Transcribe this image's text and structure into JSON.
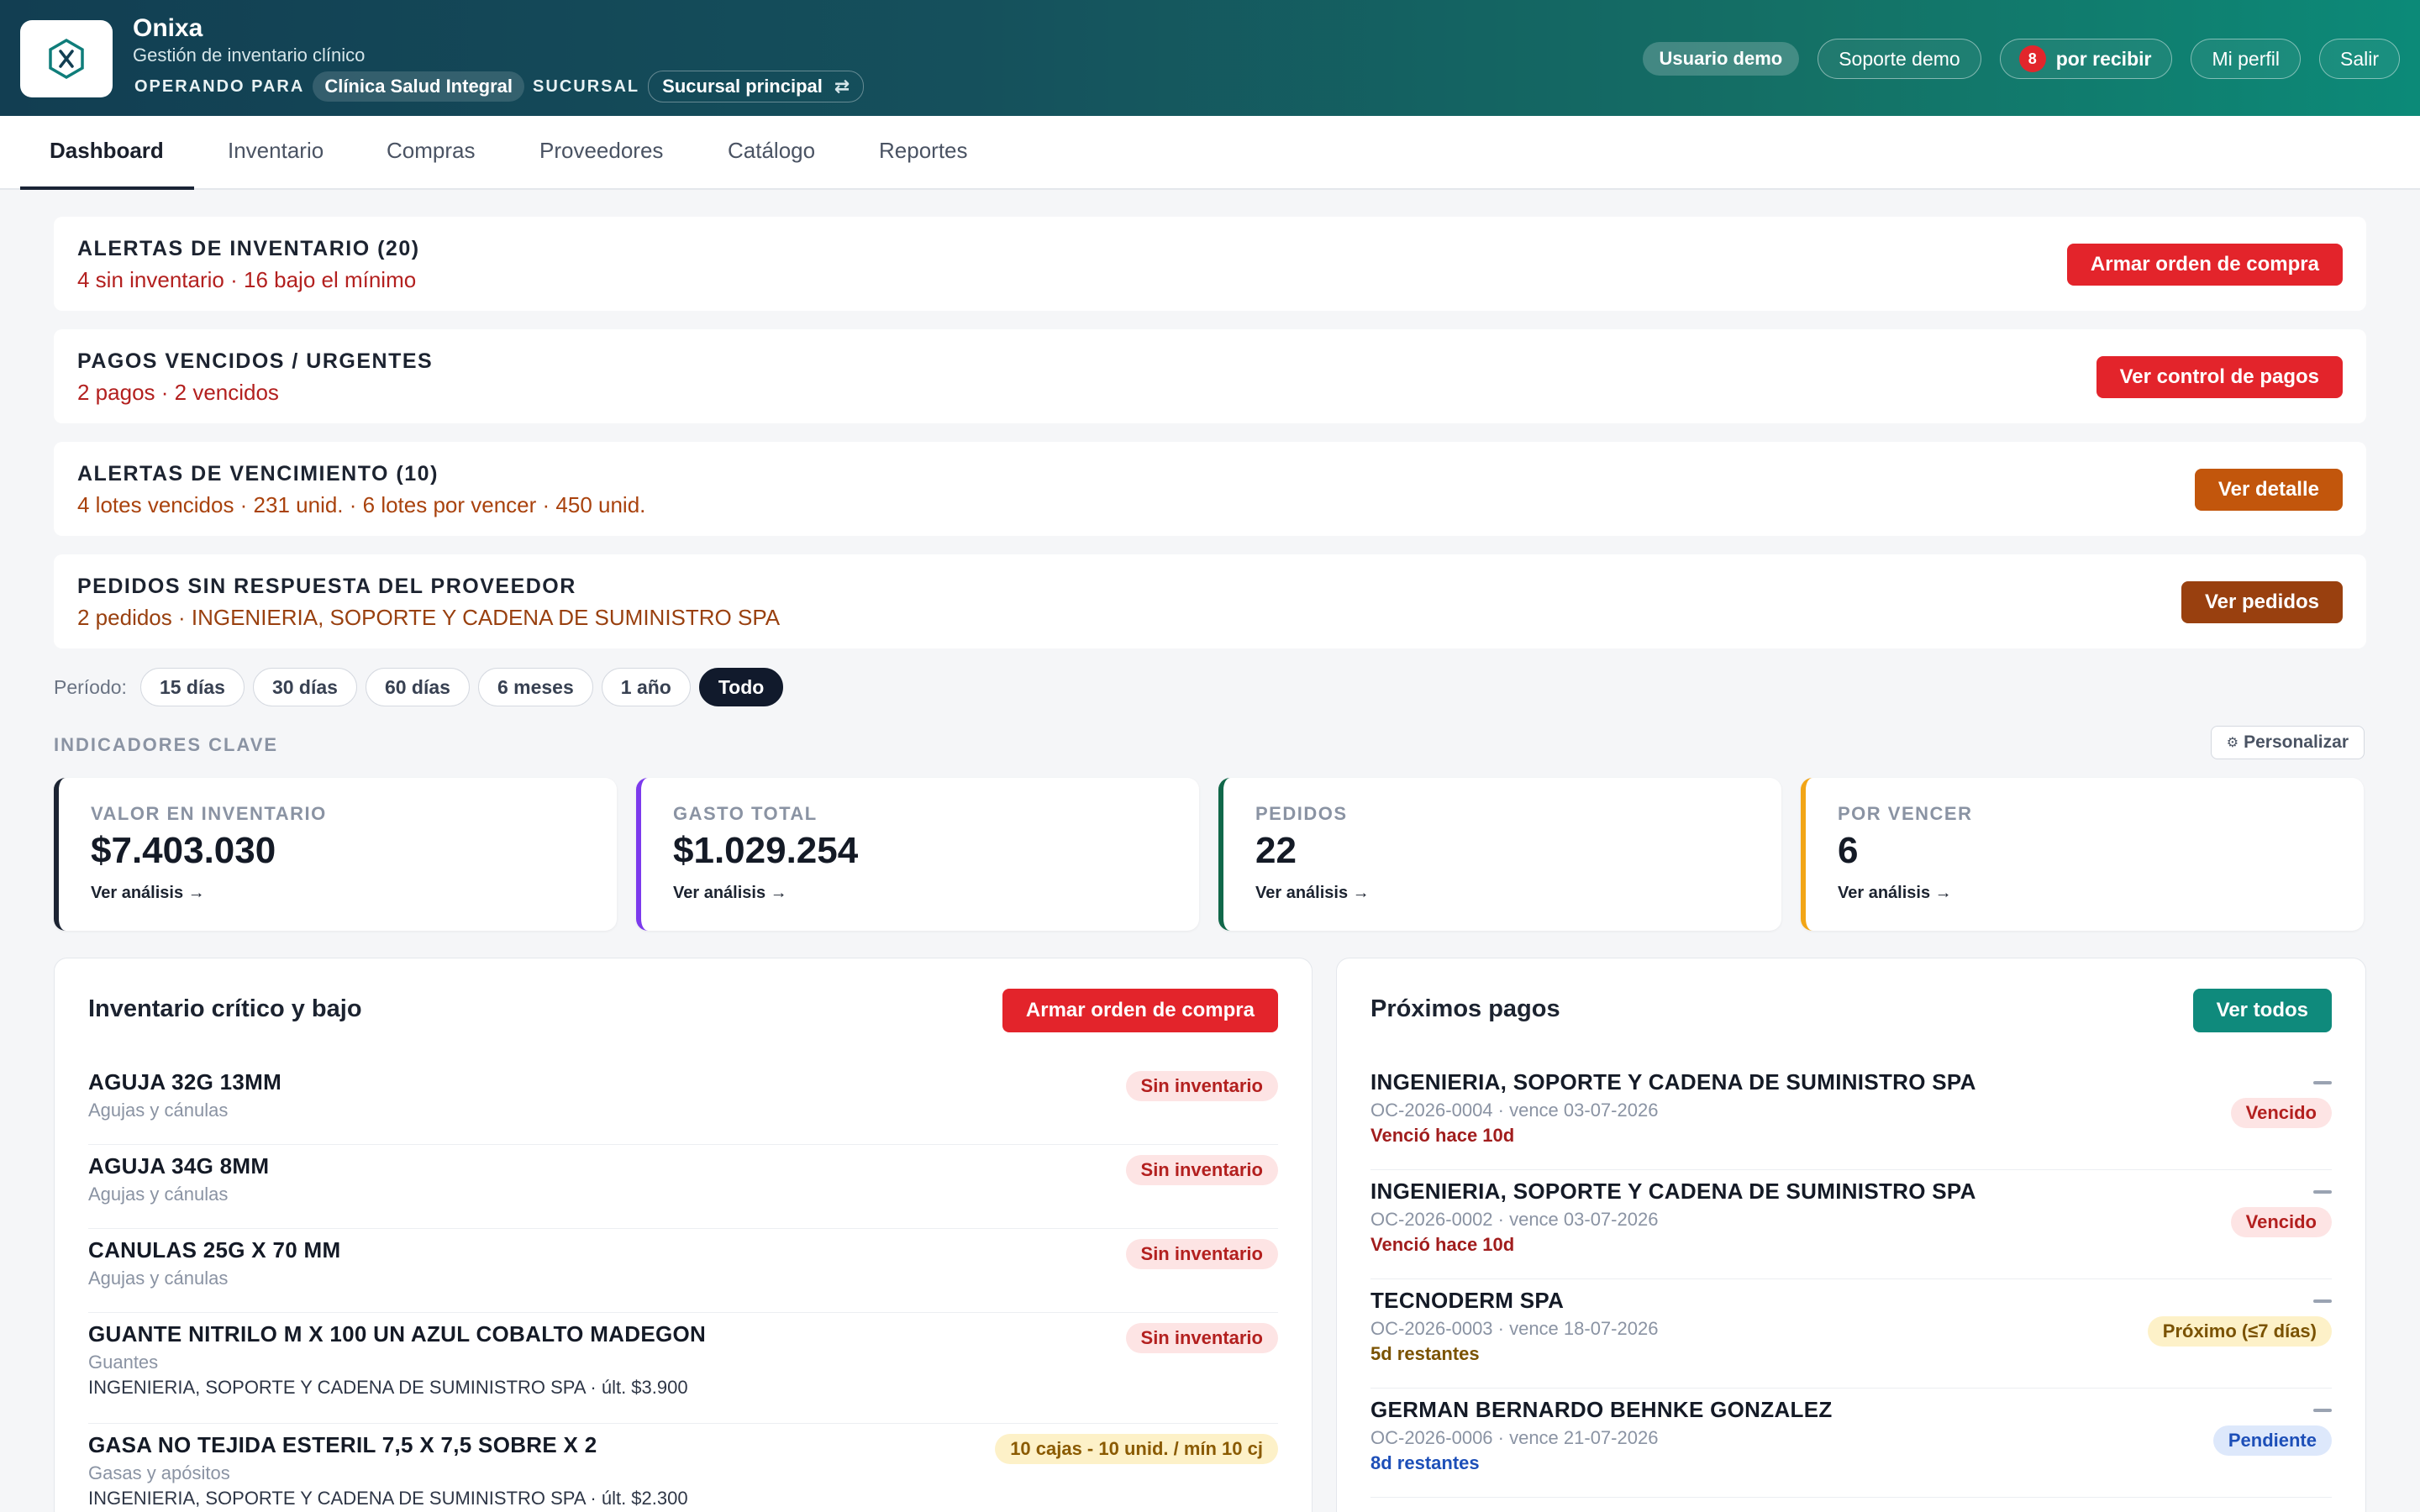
{
  "app": {
    "name": "Onixa",
    "subtitle": "Gestión de inventario clínico",
    "operando_label": "OPERANDO PARA",
    "clinic": "Clínica Salud Integral",
    "sucursal_label": "SUCURSAL",
    "sucursal": "Sucursal principal"
  },
  "header_buttons": {
    "usuario": "Usuario demo",
    "soporte": "Soporte demo",
    "recibir_count": "8",
    "recibir": "por recibir",
    "perfil": "Mi perfil",
    "salir": "Salir"
  },
  "tabs": [
    "Dashboard",
    "Inventario",
    "Compras",
    "Proveedores",
    "Catálogo",
    "Reportes"
  ],
  "alerts": [
    {
      "title": "ALERTAS DE INVENTARIO (20)",
      "summary": "4 sin inventario · 16 bajo el mínimo",
      "button": "Armar orden de compra",
      "color": "#e3242b",
      "text_color": "#b3201f"
    },
    {
      "title": "PAGOS VENCIDOS / URGENTES",
      "summary": "2 pagos · 2 vencidos",
      "button": "Ver control de pagos",
      "color": "#e3242b",
      "text_color": "#b3201f"
    },
    {
      "title": "ALERTAS DE VENCIMIENTO (10)",
      "summary": "4 lotes vencidos · 231 unid. · 6 lotes por vencer · 450 unid.",
      "button": "Ver detalle",
      "color": "#c2560c",
      "text_color": "#a9420d"
    },
    {
      "title": "PEDIDOS SIN RESPUESTA DEL PROVEEDOR",
      "summary": "2 pedidos · INGENIERIA, SOPORTE Y CADENA DE SUMINISTRO SPA",
      "button": "Ver pedidos",
      "color": "#99400f",
      "text_color": "#99400f"
    }
  ],
  "periodo": {
    "label": "Período:",
    "options": [
      "15 días",
      "30 días",
      "60 días",
      "6 meses",
      "1 año",
      "Todo"
    ],
    "active": "Todo"
  },
  "indicadores": {
    "title": "INDICADORES CLAVE",
    "personalizar": "Personalizar"
  },
  "kpis": [
    {
      "label": "VALOR EN INVENTARIO",
      "value": "$7.403.030",
      "link": "Ver análisis →",
      "color": "#1c2433"
    },
    {
      "label": "GASTO TOTAL",
      "value": "$1.029.254",
      "link": "Ver análisis →",
      "color": "#7c3aed"
    },
    {
      "label": "PEDIDOS",
      "value": "22",
      "link": "Ver análisis →",
      "color": "#11684a"
    },
    {
      "label": "POR VENCER",
      "value": "6",
      "link": "Ver análisis →",
      "color": "#f2a516"
    }
  ],
  "inventario": {
    "title": "Inventario crítico y bajo",
    "button": "Armar orden de compra",
    "items": [
      {
        "name": "AGUJA 32G 13MM",
        "category": "Agujas y cánulas",
        "extra": "",
        "status": "Sin inventario",
        "kind": "red"
      },
      {
        "name": "AGUJA 34G 8MM",
        "category": "Agujas y cánulas",
        "extra": "",
        "status": "Sin inventario",
        "kind": "red"
      },
      {
        "name": "CANULAS 25G X 70 MM",
        "category": "Agujas y cánulas",
        "extra": "",
        "status": "Sin inventario",
        "kind": "red"
      },
      {
        "name": "GUANTE NITRILO M X 100 UN AZUL COBALTO MADEGON",
        "category": "Guantes",
        "extra": "INGENIERIA, SOPORTE Y CADENA DE SUMINISTRO SPA · últ. $3.900",
        "status": "Sin inventario",
        "kind": "red"
      },
      {
        "name": "GASA NO TEJIDA ESTERIL 7,5 X 7,5 SOBRE X 2",
        "category": "Gasas y apósitos",
        "extra": "INGENIERIA, SOPORTE Y CADENA DE SUMINISTRO SPA · últ. $2.300",
        "status": "10 cajas - 10 unid. / mín 10 cj",
        "kind": "yellow"
      }
    ]
  },
  "pagos": {
    "title": "Próximos pagos",
    "button": "Ver todos",
    "items": [
      {
        "name": "INGENIERIA, SOPORTE Y CADENA DE SUMINISTRO SPA",
        "ref": "OC-2026-0004 · vence 03-07-2026",
        "due": "Venció hace 10d",
        "status": "Vencido",
        "kind": "red"
      },
      {
        "name": "INGENIERIA, SOPORTE Y CADENA DE SUMINISTRO SPA",
        "ref": "OC-2026-0002 · vence 03-07-2026",
        "due": "Venció hace 10d",
        "status": "Vencido",
        "kind": "red"
      },
      {
        "name": "TECNODERM SPA",
        "ref": "OC-2026-0003 · vence 18-07-2026",
        "due": "5d restantes",
        "status": "Próximo (≤7 días)",
        "kind": "yellow"
      },
      {
        "name": "GERMAN BERNARDO BEHNKE GONZALEZ",
        "ref": "OC-2026-0006 · vence 21-07-2026",
        "due": "8d restantes",
        "status": "Pendiente",
        "kind": "blue"
      }
    ]
  }
}
